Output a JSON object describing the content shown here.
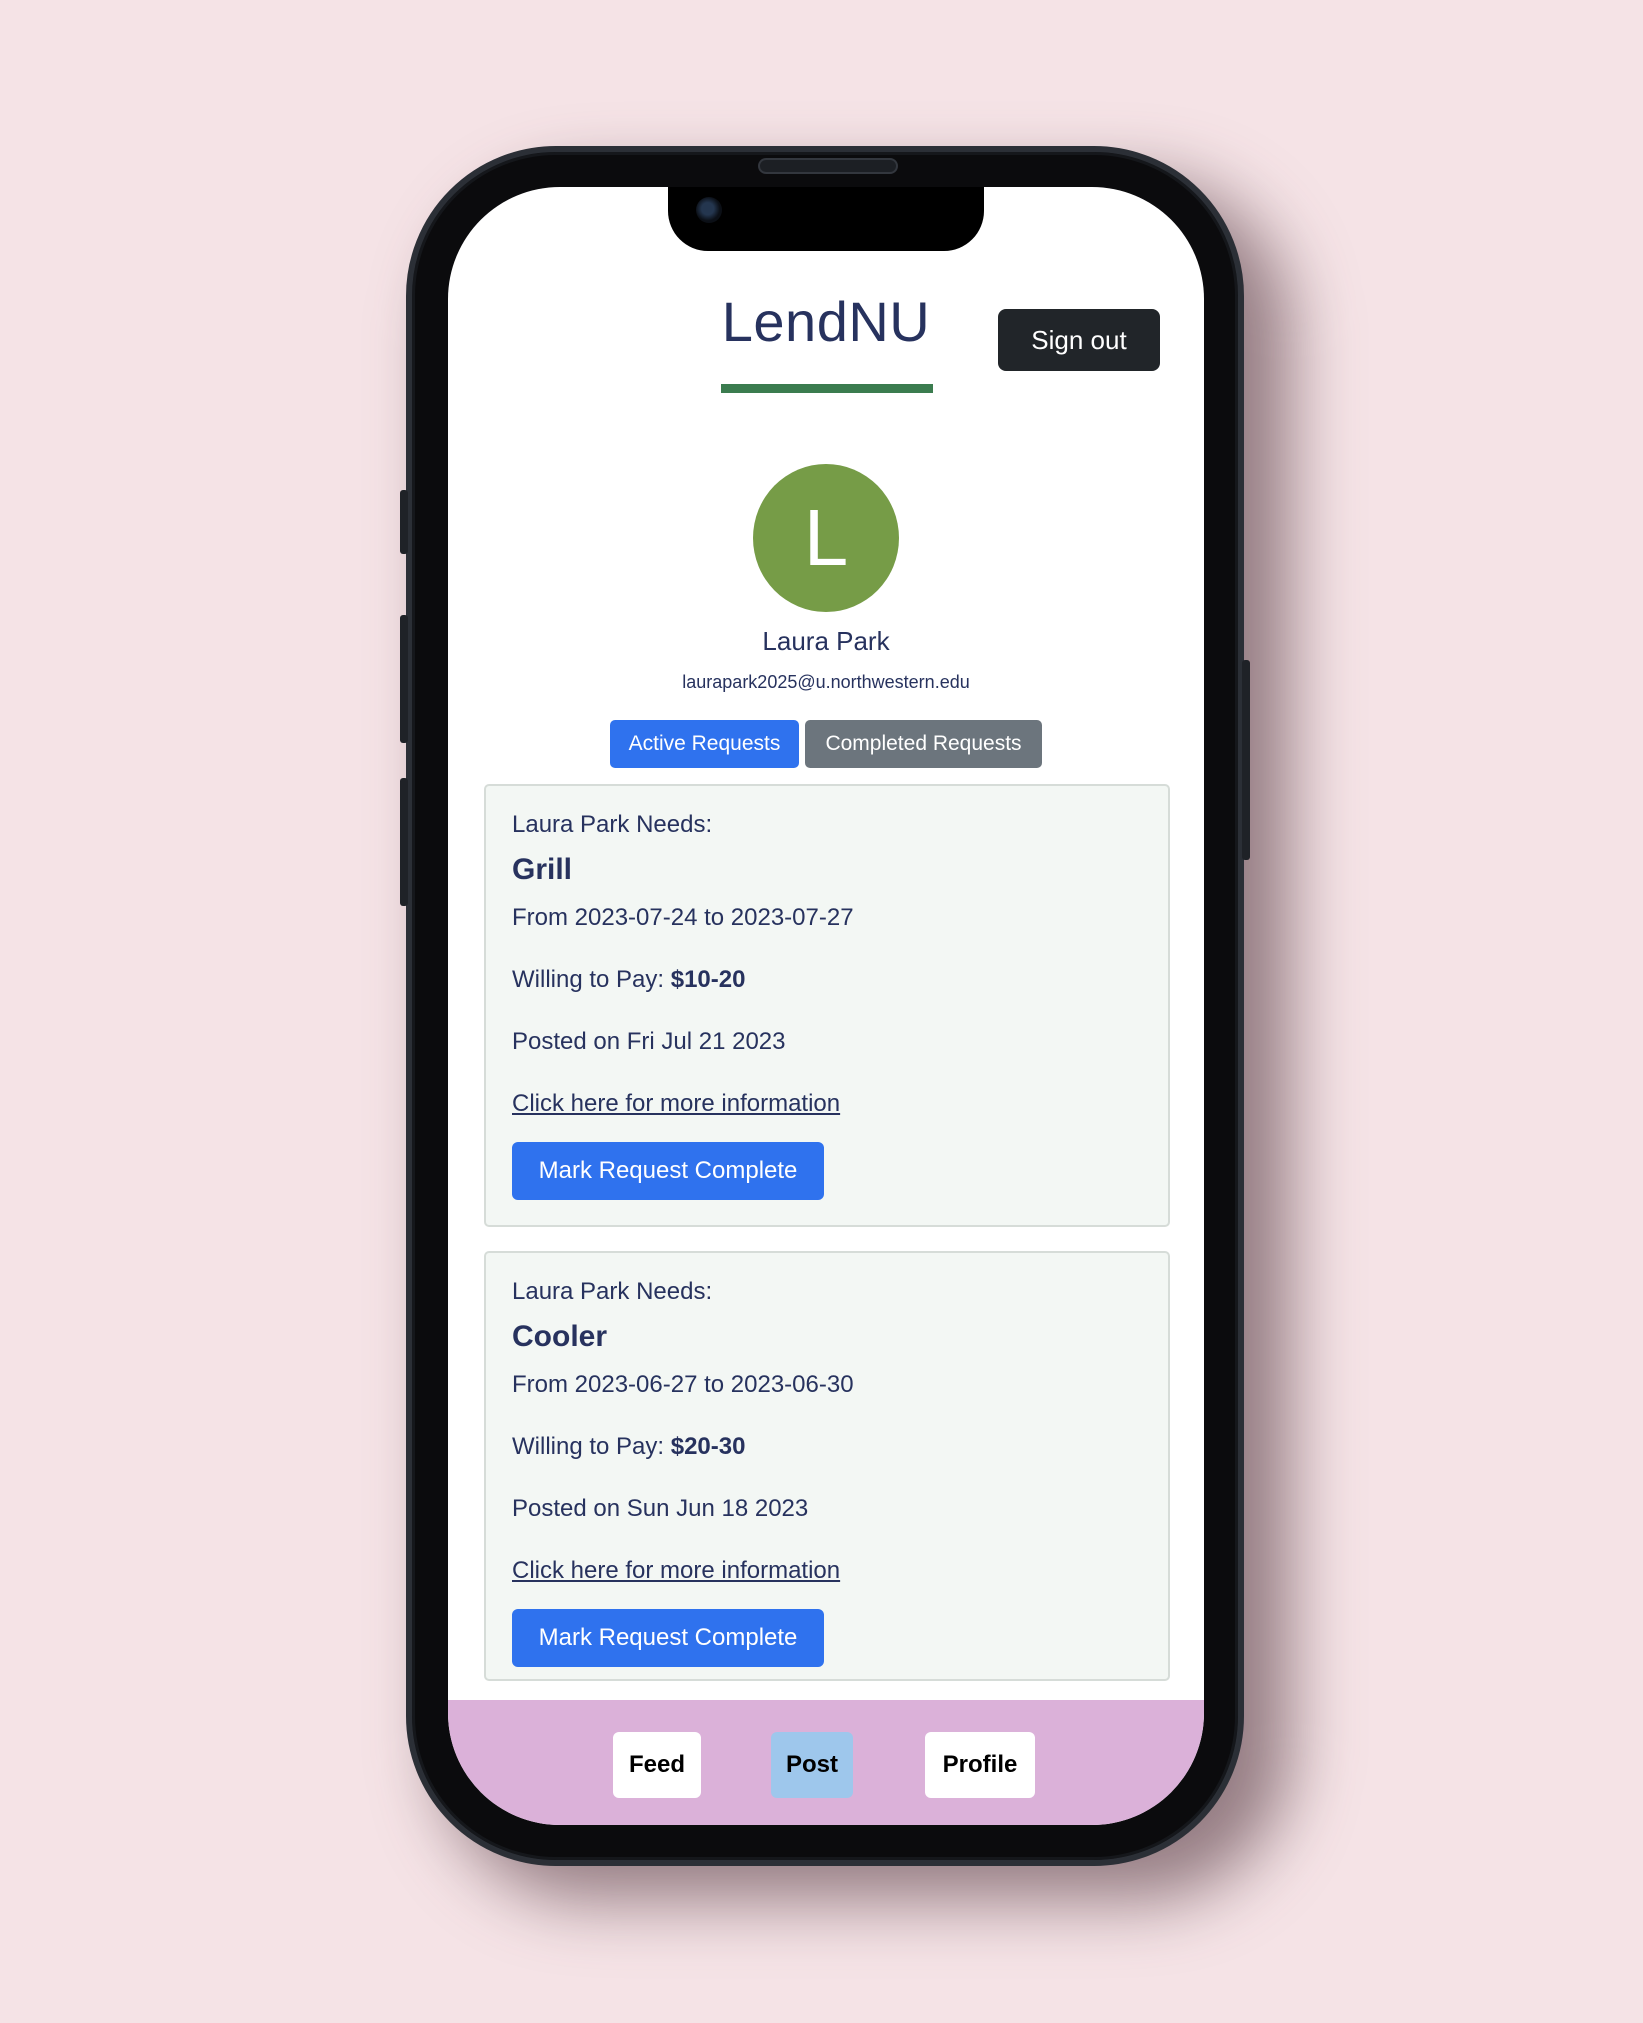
{
  "app": {
    "title": "LendNU",
    "sign_out_label": "Sign out"
  },
  "profile": {
    "avatar_initial": "L",
    "avatar_color": "#769c47",
    "name": "Laura Park",
    "email": "laurapark2025@u.northwestern.edu"
  },
  "tabs": [
    {
      "label": "Active Requests",
      "active": true
    },
    {
      "label": "Completed Requests",
      "active": false
    }
  ],
  "requests": [
    {
      "needs_label": "Laura Park Needs:",
      "item": "Grill",
      "date_range": "From 2023-07-24 to 2023-07-27",
      "pay_label": "Willing to Pay: ",
      "pay_value": "$10-20",
      "posted": "Posted on Fri Jul 21 2023",
      "link_text": "Click here for more information",
      "button_label": "Mark Request Complete"
    },
    {
      "needs_label": "Laura Park Needs:",
      "item": "Cooler",
      "date_range": "From 2023-06-27 to 2023-06-30",
      "pay_label": "Willing to Pay: ",
      "pay_value": "$20-30",
      "posted": "Posted on Sun Jun 18 2023",
      "link_text": "Click here for more information",
      "button_label": "Mark Request Complete"
    }
  ],
  "bottom_nav": [
    {
      "label": "Feed",
      "active": false
    },
    {
      "label": "Post",
      "active": true
    },
    {
      "label": "Profile",
      "active": false
    }
  ],
  "colors": {
    "page_background": "#f5e3e6",
    "primary_blue": "#2f72ee",
    "title_navy": "#27325e",
    "accent_green": "#3b7c4f",
    "nav_background": "#dbb1d9",
    "nav_active": "#9ec7ec"
  }
}
